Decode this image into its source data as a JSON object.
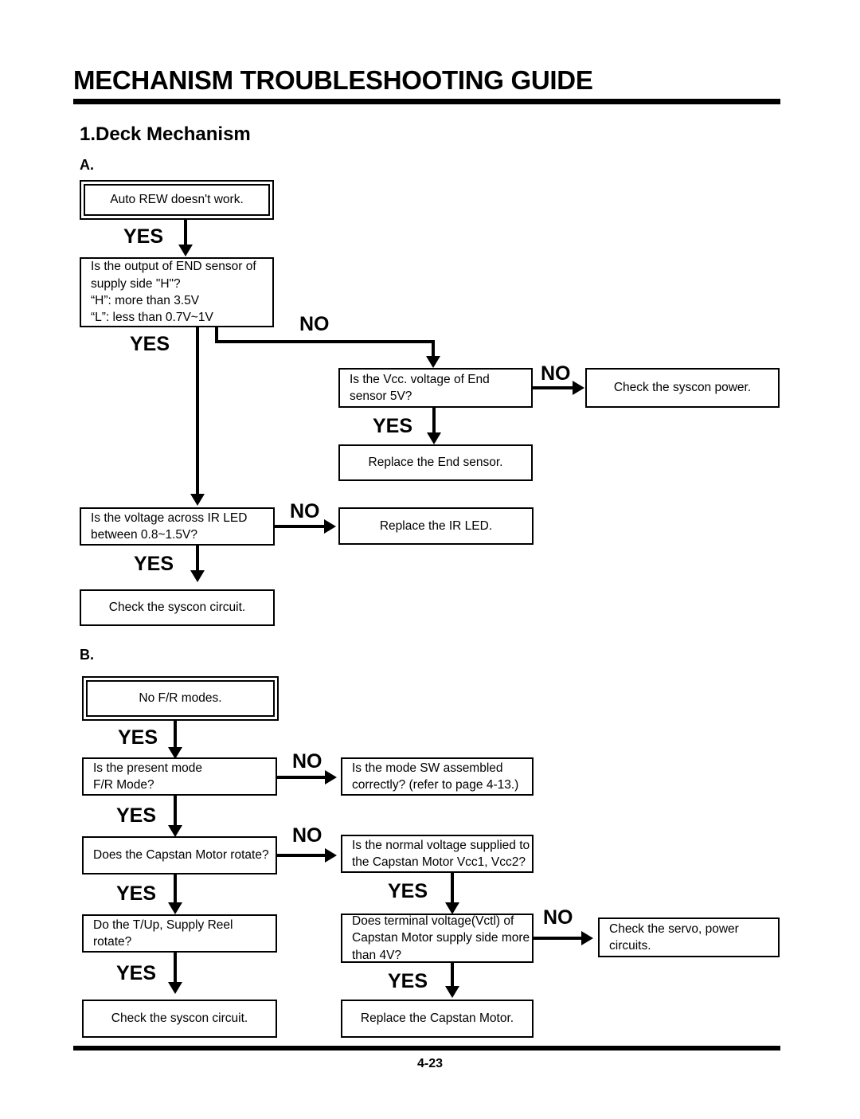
{
  "document": {
    "title": "MECHANISM TROUBLESHOOTING GUIDE",
    "section_title": "1.Deck Mechanism",
    "page_number": "4-23"
  },
  "groups": [
    {
      "label": "A."
    },
    {
      "label": "B."
    }
  ],
  "labels": {
    "yes": "YES",
    "no": "NO"
  },
  "flowchart_a": {
    "start": "Auto REW doesn't work.",
    "end_sensor_question": "Is the output of END sensor of supply side \"H\"?\n“H”: more than 3.5V\n“L”: less than 0.7V~1V",
    "end_sensor_line1": "Is the output of END sensor of",
    "end_sensor_line2": "supply side \"H\"?",
    "end_sensor_line3": "“H”: more than 3.5V",
    "end_sensor_line4": "“L”: less than 0.7V~1V",
    "vcc_question_line1": "Is the Vcc. voltage of End",
    "vcc_question_line2": "sensor 5V?",
    "check_syscon_power": "Check the syscon power.",
    "replace_end_sensor": "Replace the End sensor.",
    "ir_led_question_line1": "Is the voltage across IR LED",
    "ir_led_question_line2": "between 0.8~1.5V?",
    "replace_ir_led": "Replace the IR LED.",
    "check_syscon_circuit": "Check the syscon circuit."
  },
  "flowchart_b": {
    "start": "No F/R modes.",
    "present_mode_line1": "Is the present mode",
    "present_mode_line2": "F/R Mode?",
    "mode_sw_line1": "Is the mode SW assembled",
    "mode_sw_line2": "correctly? (refer to page 4-13.)",
    "capstan_rotate": "Does the Capstan Motor rotate?",
    "normal_voltage_line1": "Is the normal voltage supplied to",
    "normal_voltage_line2": "the Capstan Motor Vcc1, Vcc2?",
    "reel_rotate_line1": "Do the T/Up, Supply Reel",
    "reel_rotate_line2": "rotate?",
    "terminal_voltage_line1": "Does terminal voltage(Vctl) of",
    "terminal_voltage_line2": "Capstan Motor supply side more",
    "terminal_voltage_line3": "than 4V?",
    "check_servo_line1": "Check the servo, power",
    "check_servo_line2": "circuits.",
    "check_syscon_circuit": "Check the syscon circuit.",
    "replace_capstan_motor": "Replace the Capstan Motor."
  }
}
